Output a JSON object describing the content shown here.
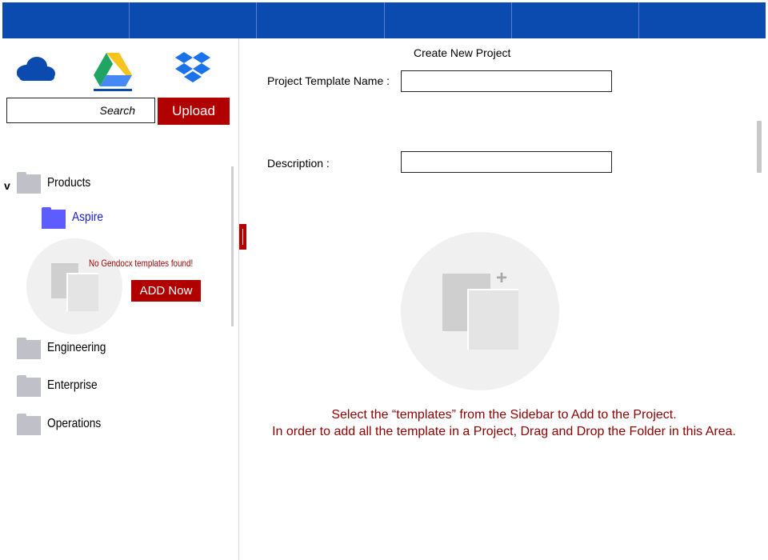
{
  "topbar": {
    "segments": 6
  },
  "sidebar": {
    "cloud_services": [
      "onedrive-icon",
      "google-drive-icon",
      "dropbox-icon"
    ],
    "search": {
      "placeholder": "Search",
      "value": ""
    },
    "upload_label": "Upload",
    "tree": {
      "expand_caret": "v",
      "products": "Products",
      "aspire": "Aspire",
      "no_templates_message": "No Gendocx templates found!",
      "add_now_label": "ADD Now",
      "engineering": "Engineering",
      "enterprise": "Enterprise",
      "operations": "Operations"
    }
  },
  "main": {
    "title": "Create New Project",
    "template_name_label": "Project Template Name :",
    "template_name_value": "",
    "description_label": "Description :",
    "description_value": "",
    "instruction_line1": "Select the “templates” from the Sidebar to Add to the Project.",
    "instruction_line2": "In order to add all the template in a Project, Drag and Drop the Folder in this Area."
  },
  "colors": {
    "topbar": "#0b4aaf",
    "accent_red": "#b00000",
    "instruction_text": "#8b0000",
    "folder_gray": "#c0c0c9",
    "folder_selected": "#5c5cff",
    "selected_text": "#1a1ad6"
  }
}
